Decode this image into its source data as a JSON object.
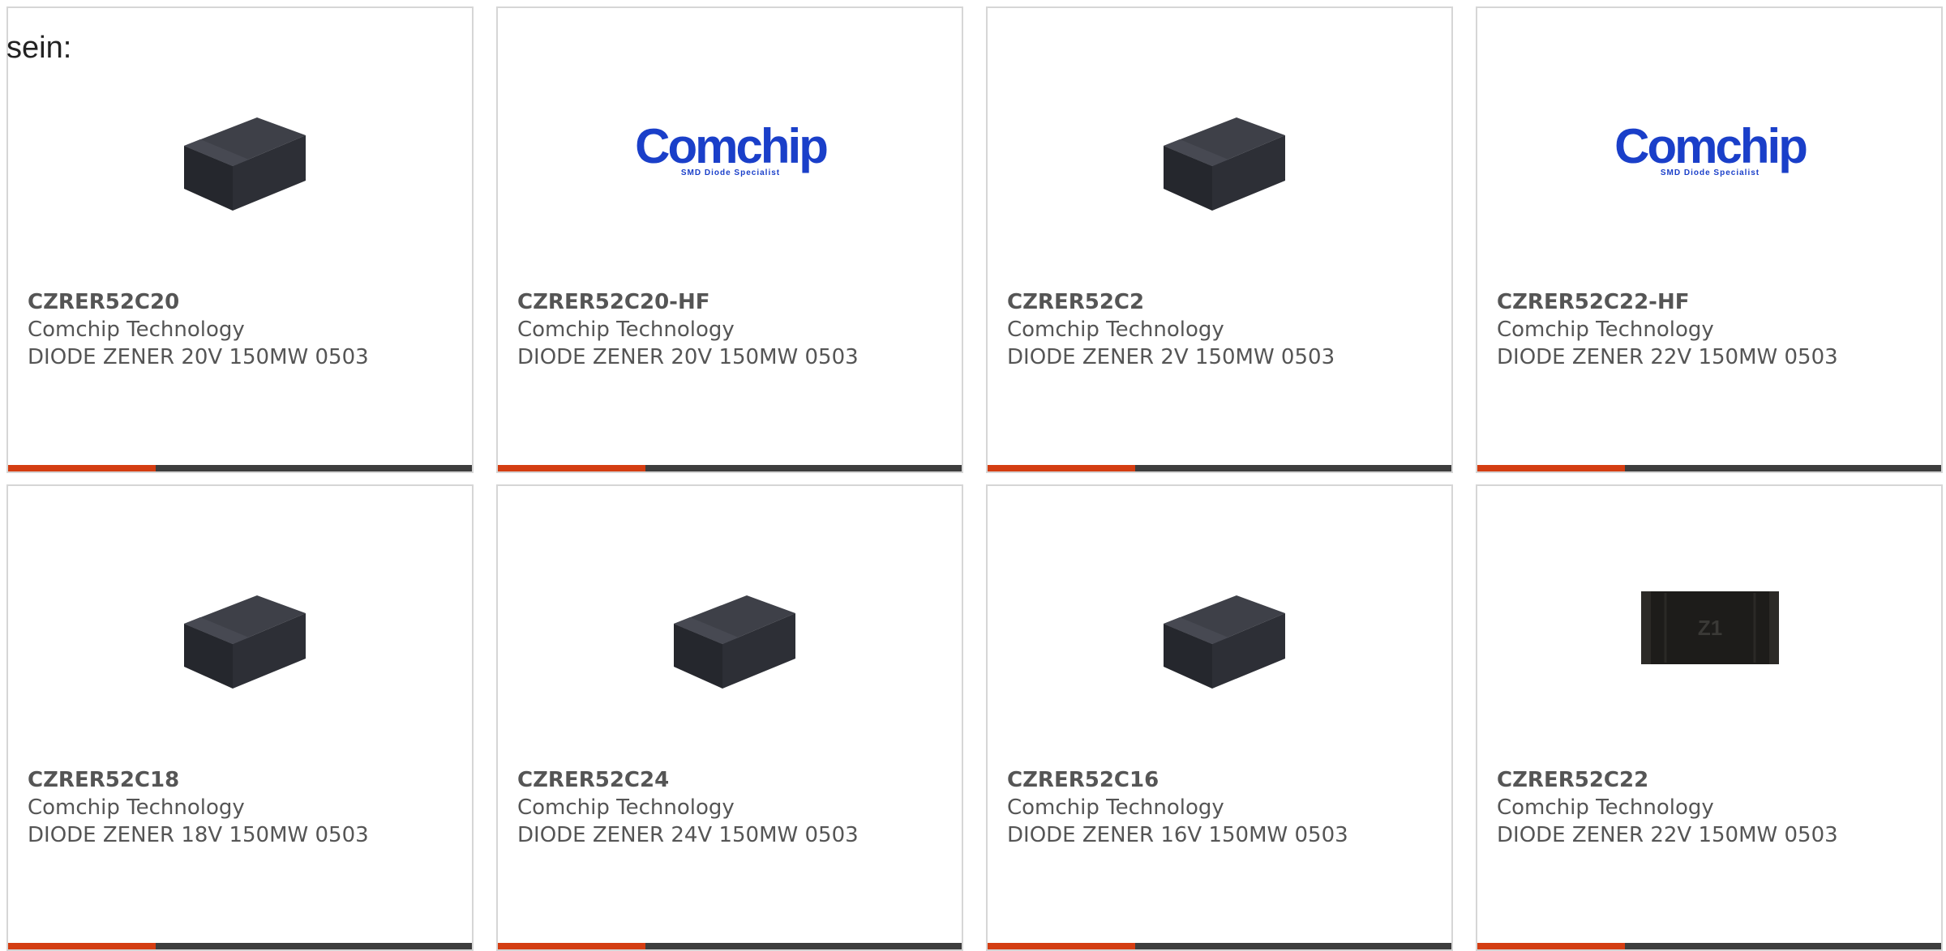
{
  "intro_text": "sein:",
  "colors": {
    "accent": "#d43d12",
    "bar": "#3d3d3d",
    "text": "#555555",
    "brand_blue": "#1a3fc9"
  },
  "products": [
    {
      "part": "CZRER52C20",
      "maker": "Comchip Technology",
      "desc": "DIODE ZENER 20V 150MW 0503",
      "image": "smd-package-icon"
    },
    {
      "part": "CZRER52C20-HF",
      "maker": "Comchip Technology",
      "desc": "DIODE ZENER 20V 150MW 0503",
      "image": "comchip-logo",
      "logo_word": "Comchip",
      "logo_tag": "SMD Diode Specialist"
    },
    {
      "part": "CZRER52C2",
      "maker": "Comchip Technology",
      "desc": "DIODE ZENER 2V 150MW 0503",
      "image": "smd-package-icon"
    },
    {
      "part": "CZRER52C22-HF",
      "maker": "Comchip Technology",
      "desc": "DIODE ZENER 22V 150MW 0503",
      "image": "comchip-logo",
      "logo_word": "Comchip",
      "logo_tag": "SMD Diode Specialist"
    },
    {
      "part": "CZRER52C18",
      "maker": "Comchip Technology",
      "desc": "DIODE ZENER 18V 150MW 0503",
      "image": "smd-package-icon"
    },
    {
      "part": "CZRER52C24",
      "maker": "Comchip Technology",
      "desc": "DIODE ZENER 24V 150MW 0503",
      "image": "smd-package-icon"
    },
    {
      "part": "CZRER52C16",
      "maker": "Comchip Technology",
      "desc": "DIODE ZENER 16V 150MW 0503",
      "image": "smd-package-icon"
    },
    {
      "part": "CZRER52C22",
      "maker": "Comchip Technology",
      "desc": "DIODE ZENER 22V 150MW 0503",
      "image": "smd-chip-top-icon",
      "chip_marking": "Z1"
    }
  ]
}
